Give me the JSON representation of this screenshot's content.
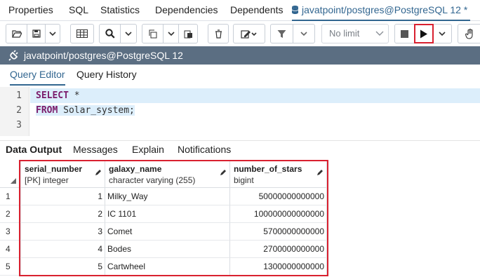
{
  "top_tabs": {
    "properties": "Properties",
    "sql": "SQL",
    "statistics": "Statistics",
    "dependencies": "Dependencies",
    "dependents": "Dependents",
    "query_tab": "javatpoint/postgres@PostgreSQL 12 *"
  },
  "toolbar": {
    "limit_label": "No limit"
  },
  "connection": {
    "label": "javatpoint/postgres@PostgreSQL 12"
  },
  "editor_tabs": {
    "query_editor": "Query Editor",
    "query_history": "Query History"
  },
  "editor": {
    "lines": [
      {
        "num": "1",
        "kw": "SELECT",
        "rest": " *"
      },
      {
        "num": "2",
        "kw": "FROM",
        "rest": " Solar_system;"
      },
      {
        "num": "3",
        "kw": "",
        "rest": ""
      }
    ]
  },
  "result_tabs": {
    "data_output": "Data Output",
    "messages": "Messages",
    "explain": "Explain",
    "notifications": "Notifications"
  },
  "grid": {
    "columns": [
      {
        "name": "serial_number",
        "type": "[PK] integer"
      },
      {
        "name": "galaxy_name",
        "type": "character varying (255)"
      },
      {
        "name": "number_of_stars",
        "type": "bigint"
      }
    ],
    "rows": [
      {
        "n": "1",
        "serial": "1",
        "galaxy": "Milky_Way",
        "stars": "50000000000000"
      },
      {
        "n": "2",
        "serial": "2",
        "galaxy": "IC 1101",
        "stars": "100000000000000"
      },
      {
        "n": "3",
        "serial": "3",
        "galaxy": "Comet",
        "stars": "5700000000000"
      },
      {
        "n": "4",
        "serial": "4",
        "galaxy": "Bodes",
        "stars": "2700000000000"
      },
      {
        "n": "5",
        "serial": "5",
        "galaxy": "Cartwheel",
        "stars": "1300000000000"
      }
    ]
  },
  "colors": {
    "accent": "#326690",
    "conn_bar": "#5b6e82",
    "highlight": "#d9202f"
  },
  "icons": [
    "database-icon",
    "open-file-icon",
    "save-icon",
    "save-dropdown-icon",
    "grid-icon",
    "search-icon",
    "search-dropdown-icon",
    "copy-icon",
    "copy-dropdown-icon",
    "paste-icon",
    "delete-icon",
    "edit-icon",
    "edit-dropdown-icon",
    "filter-icon",
    "filter-dropdown-icon",
    "stop-icon",
    "execute-icon",
    "execute-dropdown-icon",
    "hand-icon",
    "plug-icon",
    "pencil-icon",
    "sort-corner-icon"
  ]
}
